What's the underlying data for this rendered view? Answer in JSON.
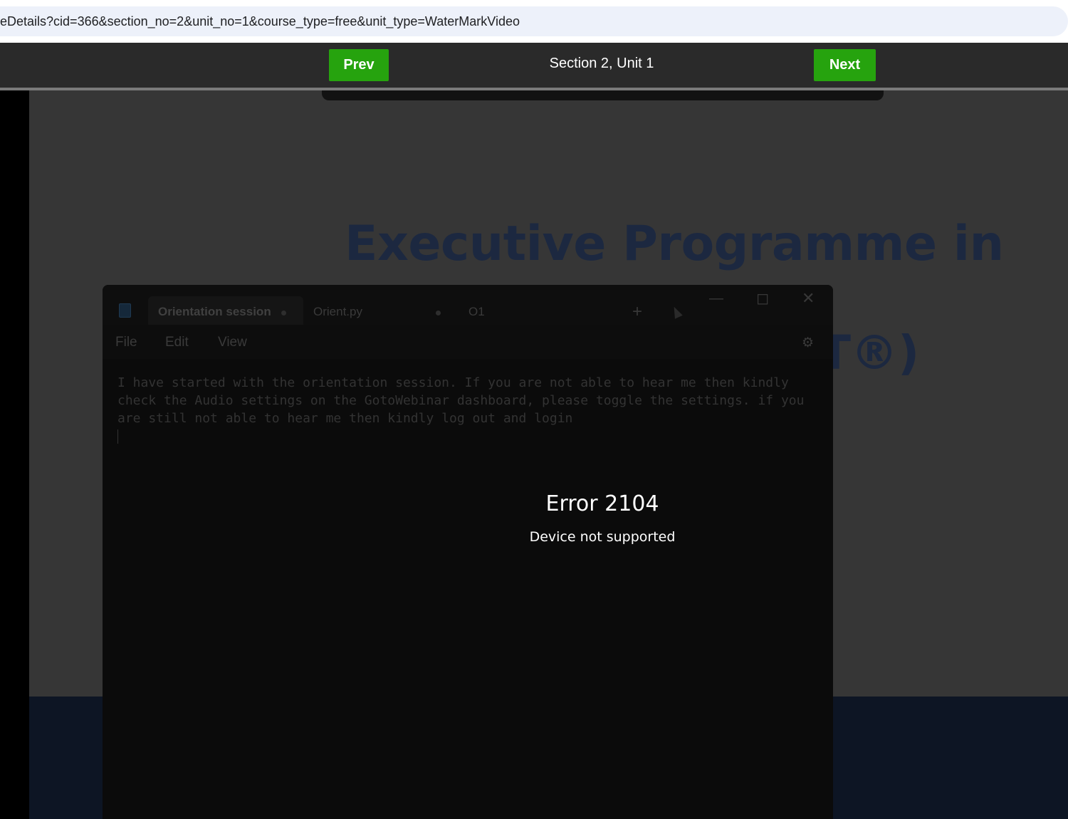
{
  "browser": {
    "url": "eDetails?cid=366&section_no=2&unit_no=1&course_type=free&unit_type=WaterMarkVideo"
  },
  "unit_nav": {
    "prev_label": "Prev",
    "next_label": "Next",
    "title": "Section 2, Unit 1"
  },
  "slide": {
    "title_line1": "Executive Programme in",
    "title_line2_fragment": "T®)"
  },
  "notepad": {
    "tabs": [
      {
        "label": "Orientation session"
      },
      {
        "label": "Orient.py"
      },
      {
        "label": "O1"
      }
    ],
    "new_tab_label": "+",
    "menu": {
      "file": "File",
      "edit": "Edit",
      "view": "View"
    },
    "text": "I have started with the orientation session. If you are not able to hear me then kindly\ncheck the Audio settings on the GotoWebinar dashboard, please toggle the settings. if you\nare still not able to hear me then kindly log out and login"
  },
  "error": {
    "code": "Error 2104",
    "message": "Device not supported"
  },
  "colors": {
    "nav_button": "#26a30e",
    "navbar_bg": "#2a2a2a",
    "slide_title": "#1c2840"
  },
  "icons": [
    "notepad-app-icon",
    "minimize-icon",
    "maximize-icon",
    "close-icon",
    "plus-icon",
    "mouse-cursor-icon",
    "gear-icon"
  ]
}
